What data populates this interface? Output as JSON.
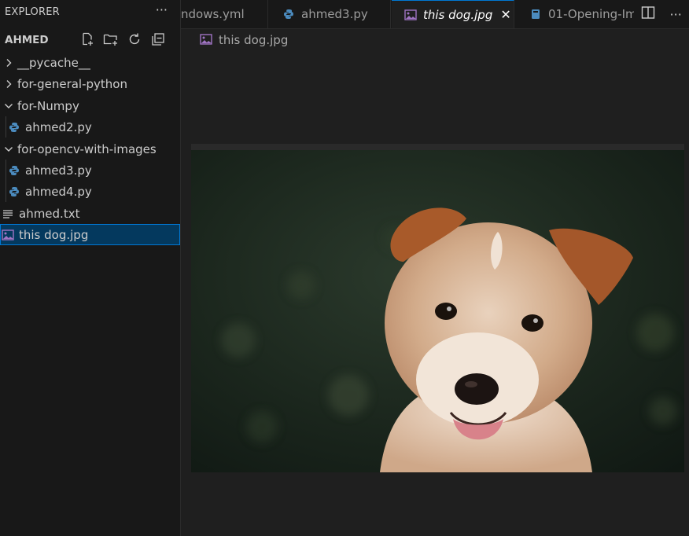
{
  "sidebar": {
    "title": "EXPLORER",
    "more_label": "···",
    "section_title": "AHMED",
    "actions": [
      {
        "name": "new-file-icon"
      },
      {
        "name": "new-folder-icon"
      },
      {
        "name": "refresh-icon"
      },
      {
        "name": "collapse-all-icon"
      }
    ],
    "items": [
      {
        "label": "__pycache__",
        "kind": "folder",
        "expanded": false
      },
      {
        "label": "for-general-python",
        "kind": "folder",
        "expanded": false
      },
      {
        "label": "for-Numpy",
        "kind": "folder",
        "expanded": true
      },
      {
        "label": "ahmed2.py",
        "kind": "python"
      },
      {
        "label": "for-opencv-with-images",
        "kind": "folder",
        "expanded": true
      },
      {
        "label": "ahmed3.py",
        "kind": "python"
      },
      {
        "label": "ahmed4.py",
        "kind": "python"
      },
      {
        "label": "ahmed.txt",
        "kind": "text"
      },
      {
        "label": "this dog.jpg",
        "kind": "image",
        "selected": true
      }
    ]
  },
  "tabs": [
    {
      "label": "ndows.yml",
      "icon": "yaml-icon"
    },
    {
      "label": "ahmed3.py",
      "icon": "python-icon"
    },
    {
      "label": "this dog.jpg",
      "icon": "image-icon",
      "active": true,
      "close": "✕"
    },
    {
      "label": "01-Opening-Im",
      "icon": "notebook-icon"
    }
  ],
  "editor": {
    "breadcrumb": "this dog.jpg",
    "image_subject": "puppy photo"
  },
  "colors": {
    "accent": "#0078d4",
    "selection": "#04395e",
    "python": "#4b8bbe",
    "image": "#a074c4"
  }
}
